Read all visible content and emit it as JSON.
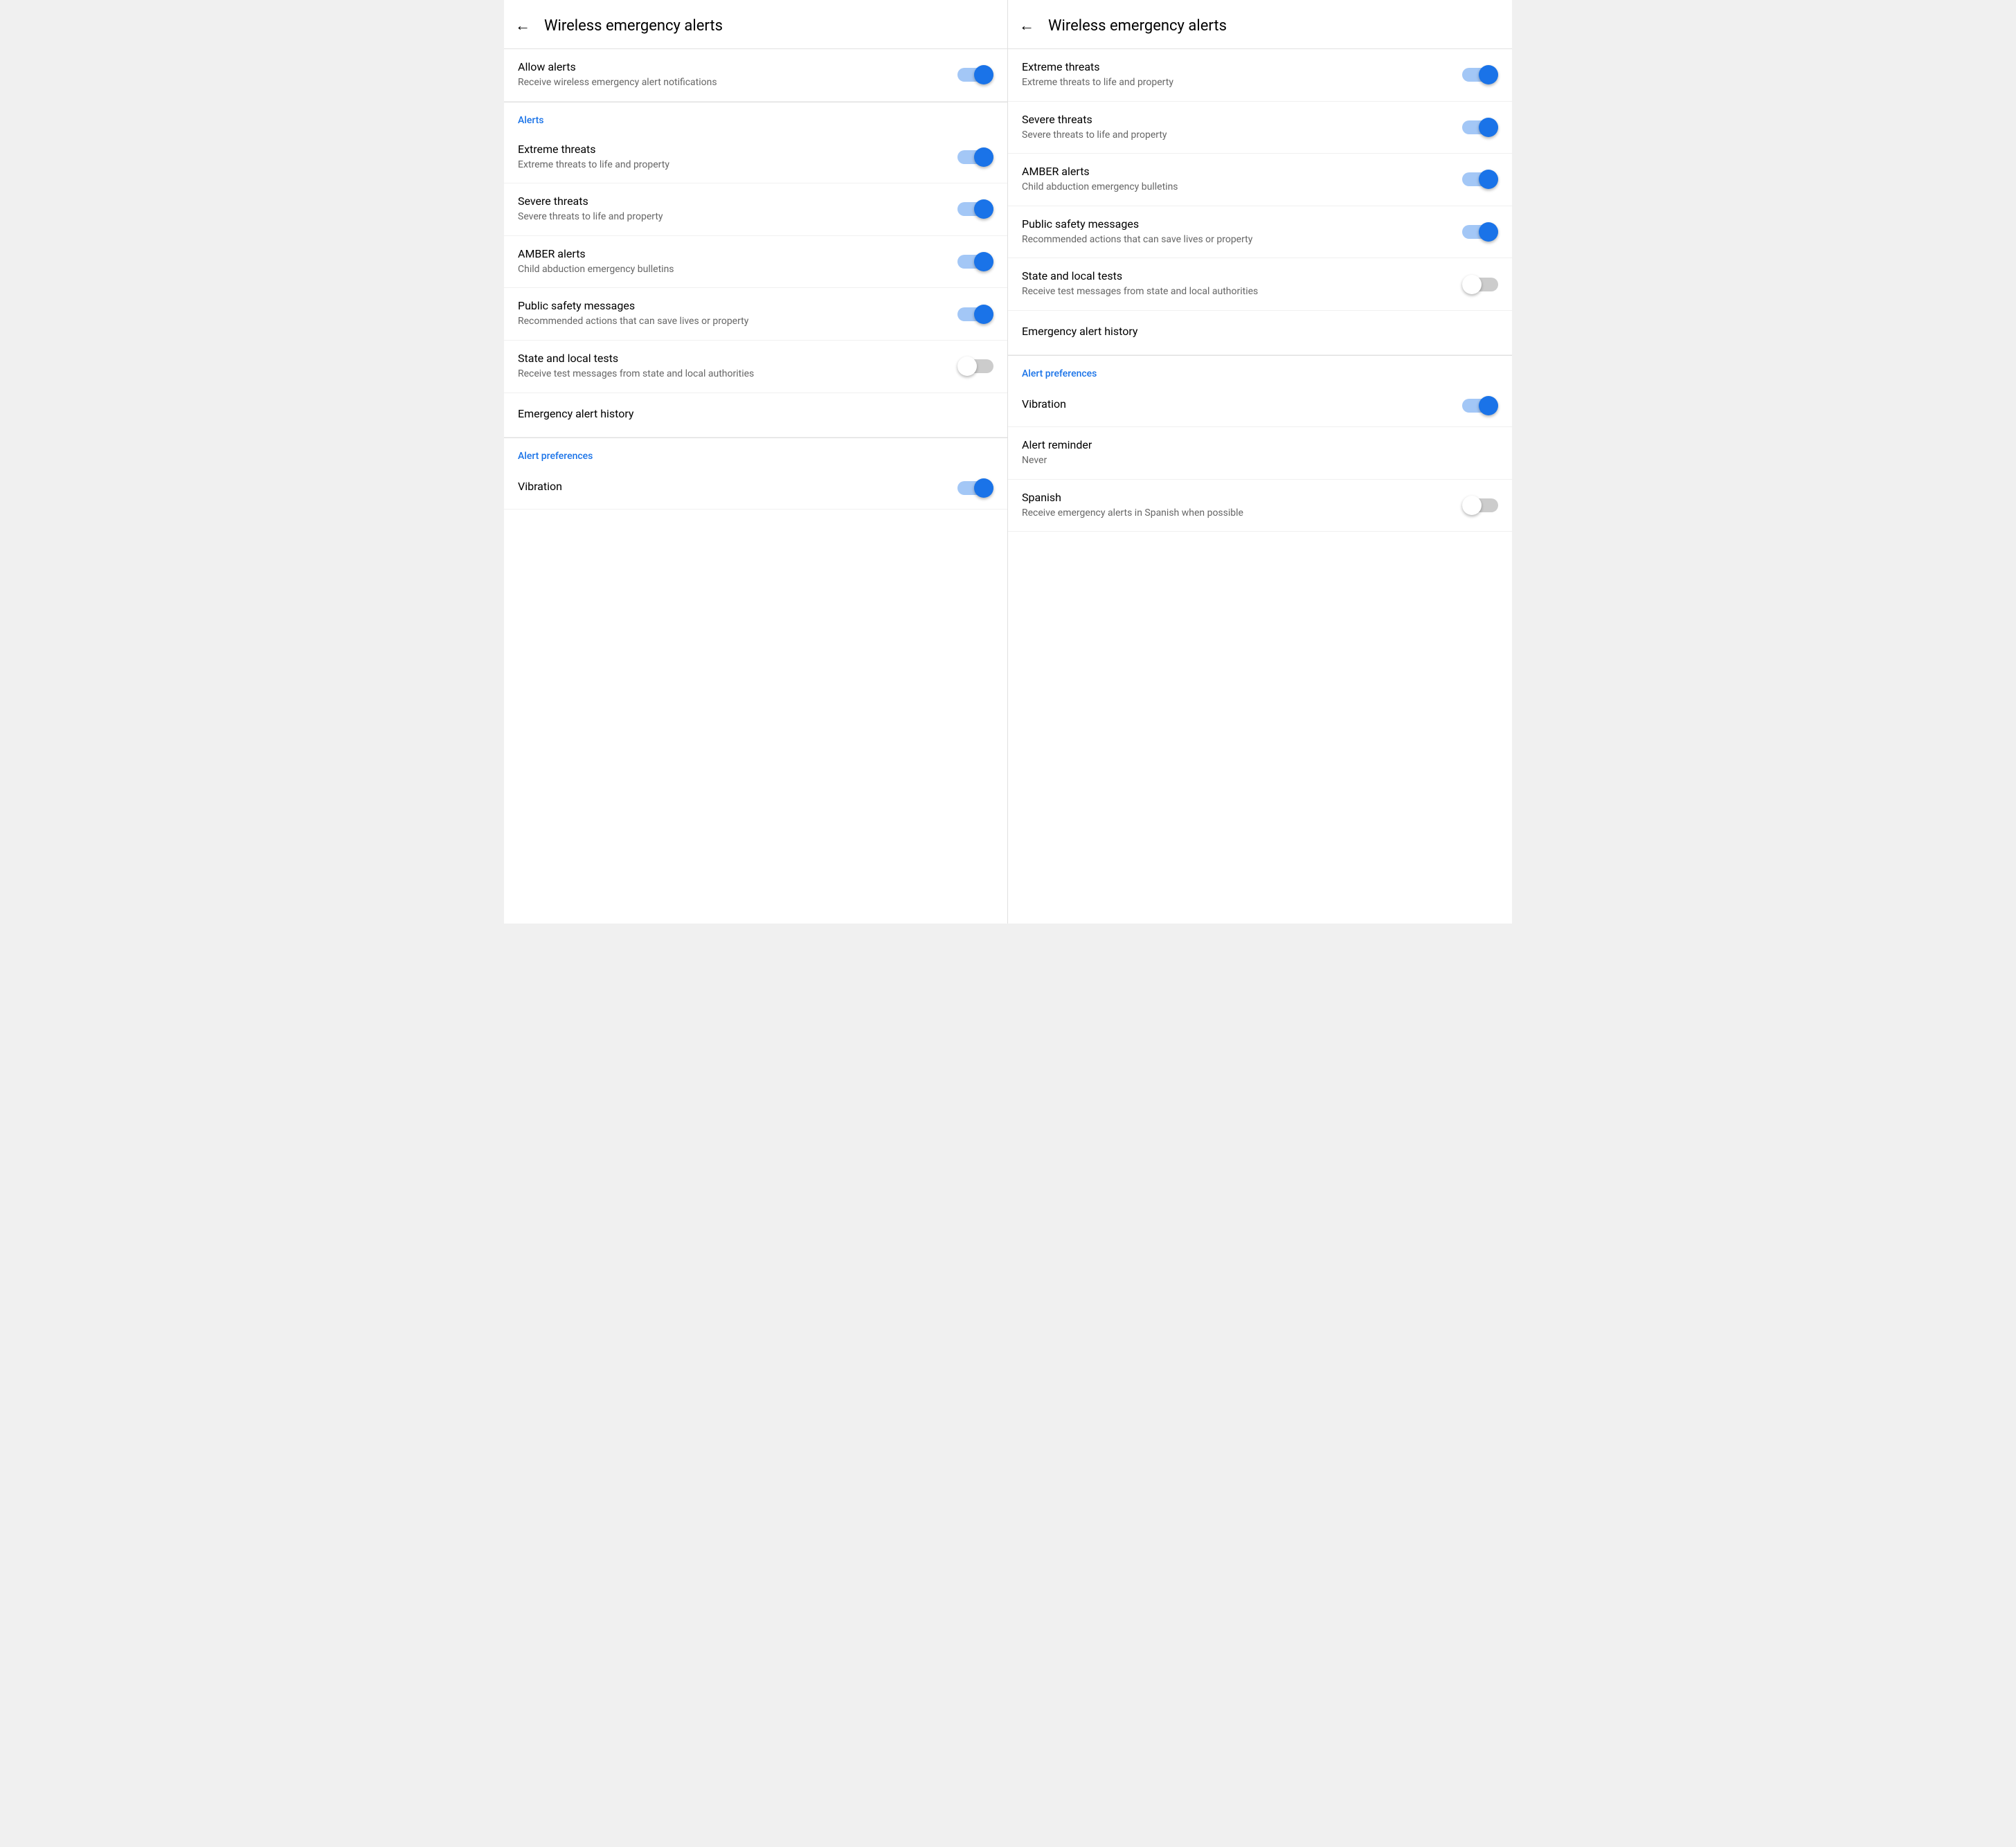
{
  "screens": [
    {
      "id": "screen-left",
      "header": {
        "back_label": "←",
        "title": "Wireless emergency alerts"
      },
      "sections": [
        {
          "id": "allow-section",
          "items": [
            {
              "id": "allow-alerts",
              "title": "Allow alerts",
              "subtitle": "Receive wireless emergency alert notifications",
              "has_toggle": true,
              "toggle_on": true
            }
          ]
        },
        {
          "id": "alerts-section",
          "label": "Alerts",
          "items": [
            {
              "id": "extreme-threats",
              "title": "Extreme threats",
              "subtitle": "Extreme threats to life and property",
              "has_toggle": true,
              "toggle_on": true
            },
            {
              "id": "severe-threats",
              "title": "Severe threats",
              "subtitle": "Severe threats to life and property",
              "has_toggle": true,
              "toggle_on": true
            },
            {
              "id": "amber-alerts",
              "title": "AMBER alerts",
              "subtitle": "Child abduction emergency bulletins",
              "has_toggle": true,
              "toggle_on": true
            },
            {
              "id": "public-safety",
              "title": "Public safety messages",
              "subtitle": "Recommended actions that can save lives or property",
              "has_toggle": true,
              "toggle_on": true
            },
            {
              "id": "state-local-tests",
              "title": "State and local tests",
              "subtitle": "Receive test messages from state and local authorities",
              "has_toggle": true,
              "toggle_on": false
            },
            {
              "id": "emergency-history",
              "title": "Emergency alert history",
              "subtitle": "",
              "has_toggle": false,
              "toggle_on": false
            }
          ]
        },
        {
          "id": "alert-prefs-section",
          "label": "Alert preferences",
          "items": [
            {
              "id": "vibration",
              "title": "Vibration",
              "subtitle": "",
              "has_toggle": true,
              "toggle_on": true
            }
          ]
        }
      ]
    },
    {
      "id": "screen-right",
      "header": {
        "back_label": "←",
        "title": "Wireless emergency alerts"
      },
      "sections": [
        {
          "id": "alerts-section-r",
          "label": "",
          "items": [
            {
              "id": "extreme-threats-r",
              "title": "Extreme threats",
              "subtitle": "Extreme threats to life and property",
              "has_toggle": true,
              "toggle_on": true
            },
            {
              "id": "severe-threats-r",
              "title": "Severe threats",
              "subtitle": "Severe threats to life and property",
              "has_toggle": true,
              "toggle_on": true
            },
            {
              "id": "amber-alerts-r",
              "title": "AMBER alerts",
              "subtitle": "Child abduction emergency bulletins",
              "has_toggle": true,
              "toggle_on": true
            },
            {
              "id": "public-safety-r",
              "title": "Public safety messages",
              "subtitle": "Recommended actions that can save lives or property",
              "has_toggle": true,
              "toggle_on": true
            },
            {
              "id": "state-local-tests-r",
              "title": "State and local tests",
              "subtitle": "Receive test messages from state and local authorities",
              "has_toggle": true,
              "toggle_on": false
            },
            {
              "id": "emergency-history-r",
              "title": "Emergency alert history",
              "subtitle": "",
              "has_toggle": false,
              "toggle_on": false
            }
          ]
        },
        {
          "id": "alert-prefs-section-r",
          "label": "Alert preferences",
          "items": [
            {
              "id": "vibration-r",
              "title": "Vibration",
              "subtitle": "",
              "has_toggle": true,
              "toggle_on": true
            },
            {
              "id": "alert-reminder-r",
              "title": "Alert reminder",
              "subtitle": "Never",
              "has_toggle": false,
              "toggle_on": false
            },
            {
              "id": "spanish-r",
              "title": "Spanish",
              "subtitle": "Receive emergency alerts in Spanish when possible",
              "has_toggle": true,
              "toggle_on": false
            }
          ]
        }
      ]
    }
  ]
}
